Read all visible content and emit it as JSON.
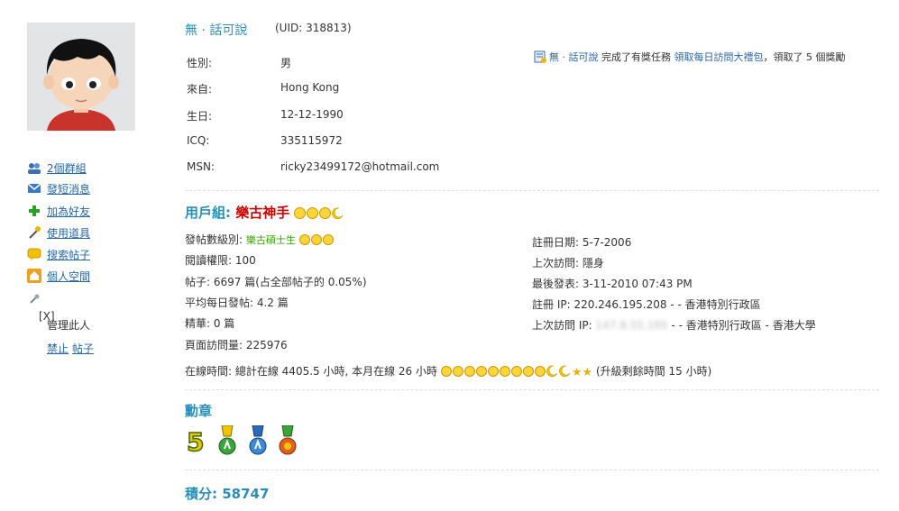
{
  "profile": {
    "username": "無 · 話可說",
    "uid": "(UID: 318813)",
    "fields": [
      {
        "label": "性別:",
        "value": "男"
      },
      {
        "label": "來自:",
        "value": "Hong Kong"
      },
      {
        "label": "生日:",
        "value": "12-12-1990"
      },
      {
        "label": "ICQ:",
        "value": "335115972"
      },
      {
        "label": "MSN:",
        "value": "ricky23499172@hotmail.com"
      }
    ]
  },
  "activity": {
    "user": "無 · 話可說",
    "text1": "完成了有獎任務",
    "task": "領取每日訪問大禮包",
    "text2": "，領取了 5 個獎勵"
  },
  "menu": {
    "groups": "2個群組",
    "message": "發短消息",
    "add_friend": "加為好友",
    "use_item": "使用道具",
    "search_posts": "搜索帖子",
    "space": "個人空間",
    "close_x": "[X]",
    "manage": "管理此人",
    "ban": "禁止",
    "posts": "帖子"
  },
  "usergroup": {
    "label": "用戶組:",
    "name": "樂古神手",
    "name_color": "#cc0000"
  },
  "stats_left": {
    "post_level_label": "發帖數級別:",
    "post_level_name": "樂古碩士生",
    "post_level_color": "#33aa00",
    "read_perm": "閱讀權限: 100",
    "posts": "帖子: 6697 篇(占全部帖子的 0.05%)",
    "avg_daily": "平均每日發帖: 4.2 篇",
    "digest": "精華: 0 篇",
    "page_views": "頁面訪問量: 225976"
  },
  "stats_right": {
    "reg_date": "註冊日期: 5-7-2006",
    "last_visit": "上次訪問: 隱身",
    "last_post": "最後發表: 3-11-2010 07:43 PM",
    "reg_ip": "註冊 IP: 220.246.195.208 - - 香港特別行政區",
    "last_ip_label": "上次訪問 IP:",
    "last_ip_blurred": "147.8.55.185",
    "last_ip_loc": "- - 香港特別行政區 - 香港大學"
  },
  "online": {
    "text": "在線時間: 總計在線 4405.5 小時, 本月在線 26 小時",
    "upgrade": "(升級剩餘時間 15 小時)"
  },
  "medals": {
    "title": "勳章"
  },
  "points": {
    "title": "積分: 58747"
  },
  "colors": {
    "accent": "#2a8fb8",
    "link": "#2866a8"
  }
}
